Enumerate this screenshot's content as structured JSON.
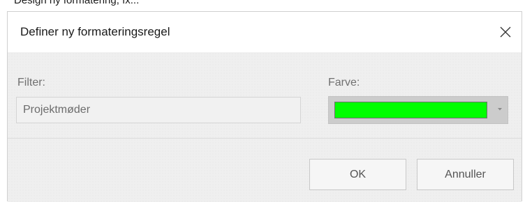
{
  "background_fragment": {
    "text": "Design ny formatering, fx..."
  },
  "dialog": {
    "title": "Definer ny formateringsregel",
    "close_icon": "close-icon"
  },
  "filter": {
    "label": "Filter:",
    "value": "Projektmøder"
  },
  "color": {
    "label": "Farve:",
    "selected_color": "#00ff00",
    "dropdown_icon": "chevron-down-icon"
  },
  "buttons": {
    "ok_label": "OK",
    "cancel_label": "Annuller"
  }
}
